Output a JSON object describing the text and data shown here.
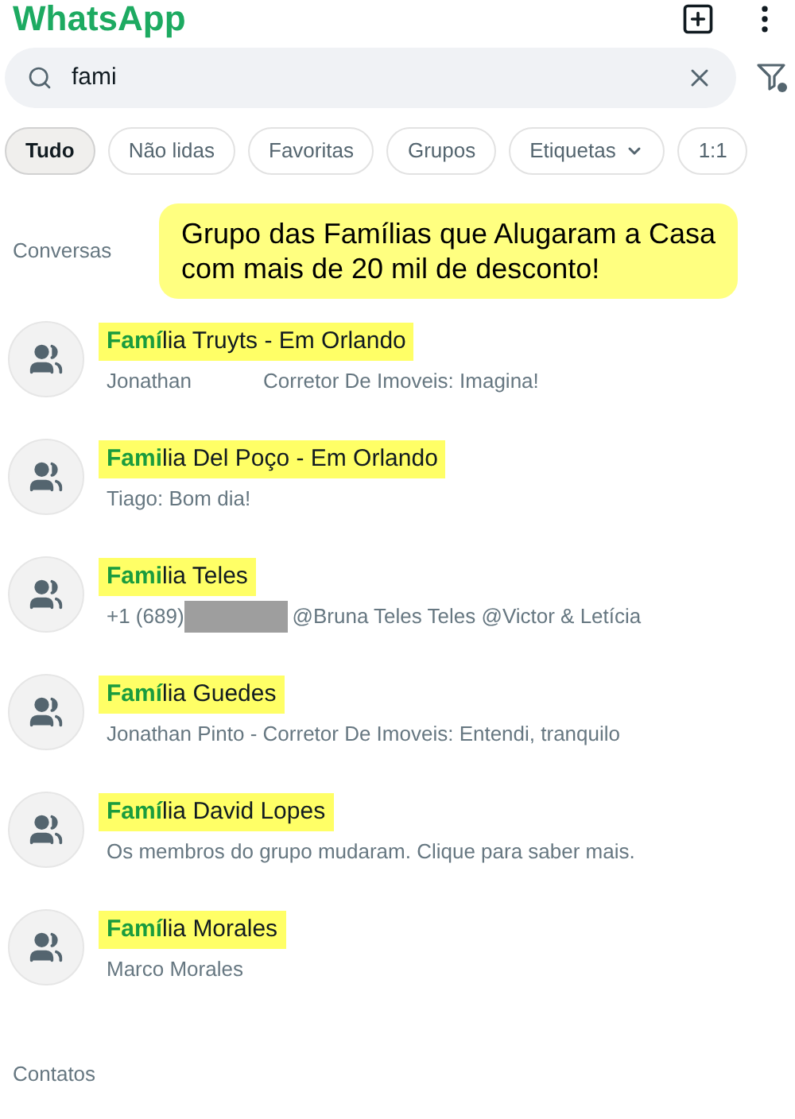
{
  "app_title": "WhatsApp",
  "search": {
    "value": "fami"
  },
  "filters": [
    {
      "label": "Tudo",
      "selected": true,
      "dropdown": false
    },
    {
      "label": "Não lidas",
      "selected": false,
      "dropdown": false
    },
    {
      "label": "Favoritas",
      "selected": false,
      "dropdown": false
    },
    {
      "label": "Grupos",
      "selected": false,
      "dropdown": false
    },
    {
      "label": "Etiquetas",
      "selected": false,
      "dropdown": true
    },
    {
      "label": "1:1",
      "selected": false,
      "dropdown": false
    }
  ],
  "callout": "Grupo das Famílias que Alugaram a Casa com mais de 20 mil de desconto!",
  "sections": [
    {
      "title": "Conversas",
      "chats": [
        {
          "match": "Famí",
          "rest": "lia Truyts - Em Orlando",
          "preview": [
            {
              "kind": "text",
              "text": "Jonathan"
            },
            {
              "kind": "blank"
            },
            {
              "kind": "text",
              "text": "Corretor De Imoveis: Imagina!"
            }
          ]
        },
        {
          "match": "Fami",
          "rest": "lia Del Poço - Em Orlando",
          "preview": [
            {
              "kind": "text",
              "text": "Tiago: Bom dia!"
            }
          ]
        },
        {
          "match": "Fami",
          "rest": "lia Teles",
          "preview": [
            {
              "kind": "text",
              "text": "+1 (689)"
            },
            {
              "kind": "redaction"
            },
            {
              "kind": "text",
              "text": "@Bruna Teles Teles @Victor & Letícia"
            }
          ]
        },
        {
          "match": "Famí",
          "rest": "lia Guedes",
          "preview": [
            {
              "kind": "text",
              "text": "Jonathan Pinto - Corretor De Imoveis: Entendi, tranquilo"
            }
          ]
        },
        {
          "match": "Famí",
          "rest": "lia David Lopes",
          "preview": [
            {
              "kind": "text",
              "text": "Os membros do grupo mudaram. Clique para saber mais."
            }
          ]
        },
        {
          "match": "Famí",
          "rest": "lia Morales",
          "preview": [
            {
              "kind": "text",
              "text": "Marco Morales"
            }
          ]
        }
      ]
    },
    {
      "title": "Contatos"
    }
  ]
}
